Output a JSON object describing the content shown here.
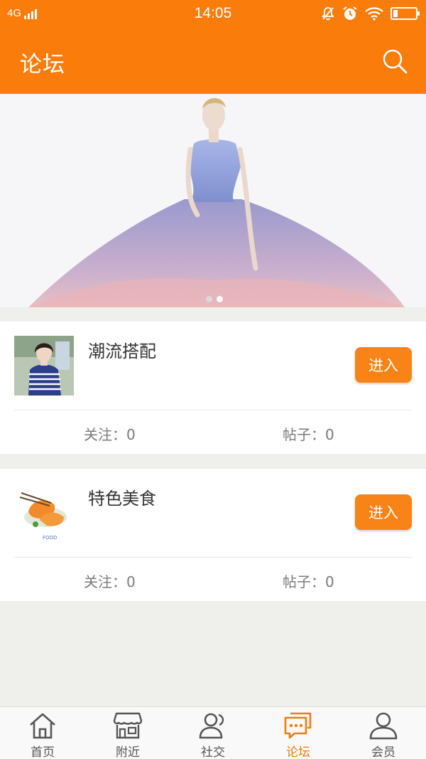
{
  "status_bar": {
    "network": "4G",
    "time": "14:05"
  },
  "header": {
    "title": "论坛",
    "search_icon": "search-icon"
  },
  "banner": {
    "image": "fashion-sketch-gown",
    "page_count": 2,
    "active_page": 2,
    "colors": {
      "dot_inactive": "#d9d9de",
      "dot_active": "#ffffff"
    }
  },
  "forums": [
    {
      "name": "潮流搭配",
      "enter_label": "进入",
      "follow_label": "关注：",
      "follow_count": "0",
      "posts_label": "帖子：",
      "posts_count": "0",
      "thumb": "woman-striped-shirt"
    },
    {
      "name": "特色美食",
      "enter_label": "进入",
      "follow_label": "关注：",
      "follow_count": "0",
      "posts_label": "帖子：",
      "posts_count": "0",
      "thumb": "food-shrimp"
    }
  ],
  "tabbar": {
    "items": [
      {
        "label": "首页",
        "icon": "home-icon",
        "active": false
      },
      {
        "label": "附近",
        "icon": "shop-icon",
        "active": false
      },
      {
        "label": "社交",
        "icon": "friends-icon",
        "active": false
      },
      {
        "label": "论坛",
        "icon": "chat-icon",
        "active": true
      },
      {
        "label": "会员",
        "icon": "user-icon",
        "active": false
      }
    ]
  },
  "colors": {
    "brand": "#fa7d0c",
    "button": "#f88417",
    "background": "#efefeb"
  }
}
